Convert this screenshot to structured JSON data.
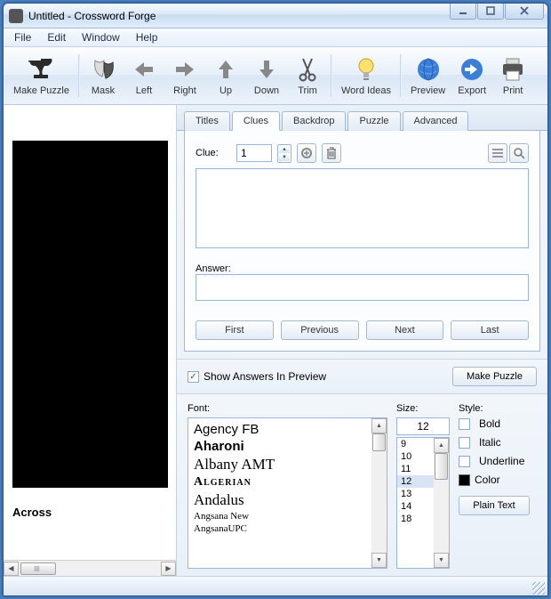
{
  "title": "Untitled - Crossword Forge",
  "menu": {
    "file": "File",
    "edit": "Edit",
    "window": "Window",
    "help": "Help"
  },
  "toolbar": {
    "make": "Make Puzzle",
    "mask": "Mask",
    "left": "Left",
    "right": "Right",
    "up": "Up",
    "down": "Down",
    "trim": "Trim",
    "ideas": "Word Ideas",
    "preview": "Preview",
    "export": "Export",
    "print": "Print"
  },
  "preview": {
    "across": "Across"
  },
  "tabs": {
    "titles": "Titles",
    "clues": "Clues",
    "backdrop": "Backdrop",
    "puzzle": "Puzzle",
    "advanced": "Advanced",
    "active": "Clues"
  },
  "clue": {
    "label": "Clue:",
    "number": "1",
    "text": "",
    "answer_label": "Answer:",
    "answer": ""
  },
  "nav": {
    "first": "First",
    "prev": "Previous",
    "next": "Next",
    "last": "Last"
  },
  "options": {
    "show_answers_label": "Show Answers In Preview",
    "show_answers_checked": true,
    "make_puzzle": "Make Puzzle"
  },
  "font": {
    "label": "Font:",
    "items": [
      "Agency FB",
      "Aharoni",
      "Albany AMT",
      "Algerian",
      "Andalus",
      "Angsana New",
      "AngsanaUPC"
    ]
  },
  "size": {
    "label": "Size:",
    "value": "12",
    "items": [
      "9",
      "10",
      "11",
      "12",
      "13",
      "14",
      "18"
    ],
    "selected": "12"
  },
  "style": {
    "label": "Style:",
    "bold": "Bold",
    "italic": "Italic",
    "underline": "Underline",
    "color": "Color",
    "plain": "Plain Text"
  }
}
